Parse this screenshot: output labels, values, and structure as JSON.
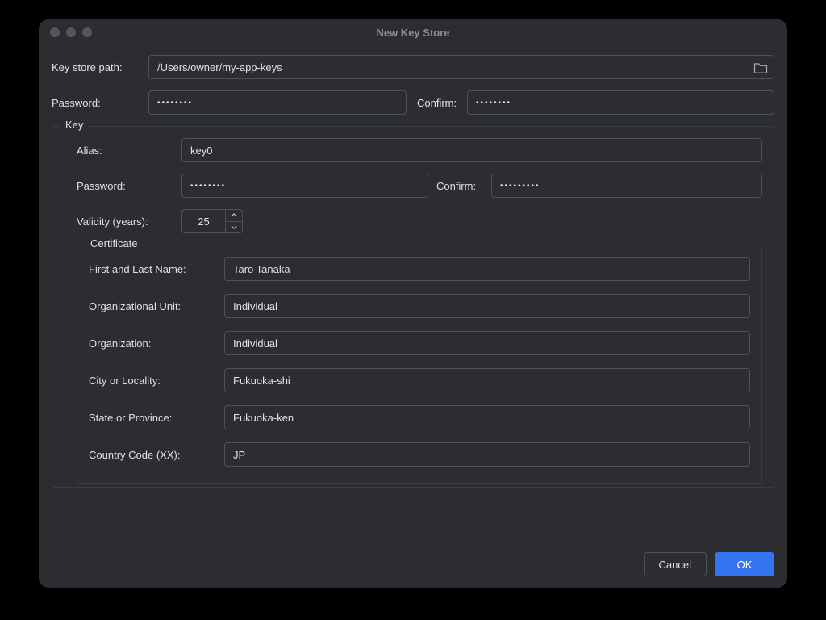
{
  "window": {
    "title": "New Key Store"
  },
  "keystore": {
    "path_label": "Key store path:",
    "path_value": "/Users/owner/my-app-keys",
    "password_label": "Password:",
    "password_value": "••••••••",
    "confirm_label": "Confirm:",
    "confirm_value": "••••••••"
  },
  "key_section": {
    "legend": "Key",
    "alias_label": "Alias:",
    "alias_value": "key0",
    "password_label": "Password:",
    "password_value": "••••••••",
    "confirm_label": "Confirm:",
    "confirm_value": "•••••••••",
    "validity_label": "Validity (years):",
    "validity_value": "25"
  },
  "cert": {
    "legend": "Certificate",
    "fields": [
      {
        "label": "First and Last Name:",
        "value": "Taro Tanaka"
      },
      {
        "label": "Organizational Unit:",
        "value": "Individual"
      },
      {
        "label": "Organization:",
        "value": "Individual"
      },
      {
        "label": "City or Locality:",
        "value": "Fukuoka-shi"
      },
      {
        "label": "State or Province:",
        "value": "Fukuoka-ken"
      },
      {
        "label": "Country Code (XX):",
        "value": "JP"
      }
    ]
  },
  "buttons": {
    "cancel": "Cancel",
    "ok": "OK"
  }
}
